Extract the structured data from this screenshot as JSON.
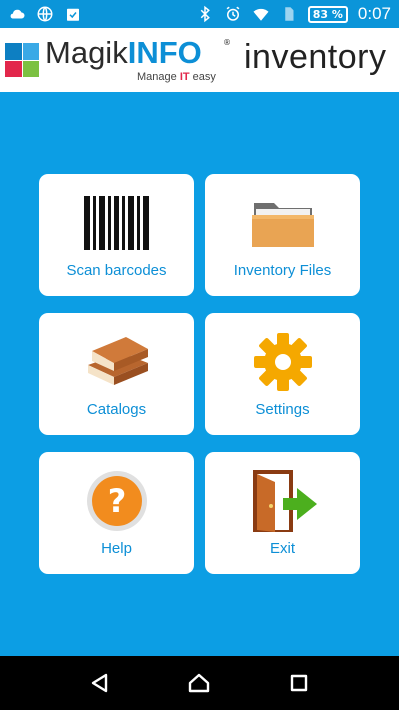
{
  "status_bar": {
    "battery_text": "83 %",
    "time": "0:07",
    "left_icons": [
      "cloud-icon",
      "globe-icon",
      "clipboard-check-icon"
    ],
    "right_icons": [
      "bluetooth-icon",
      "alarm-icon",
      "wifi-icon",
      "sim-icon"
    ]
  },
  "header": {
    "brand_magik": "Magik",
    "brand_info": "INFO",
    "registered": "®",
    "tagline_pre": "Manage ",
    "tagline_it": "IT",
    "tagline_post": " easy",
    "app_title": "inventory"
  },
  "tiles": [
    {
      "label": "Scan barcodes",
      "icon": "barcode-icon"
    },
    {
      "label": "Inventory Files",
      "icon": "folder-icon"
    },
    {
      "label": "Catalogs",
      "icon": "books-icon"
    },
    {
      "label": "Settings",
      "icon": "gear-icon"
    },
    {
      "label": "Help",
      "icon": "help-icon"
    },
    {
      "label": "Exit",
      "icon": "exit-door-icon"
    }
  ],
  "nav": {
    "buttons": [
      "back-icon",
      "home-icon",
      "recents-icon"
    ]
  },
  "colors": {
    "background": "#0c9ee4",
    "accent_text": "#0d8fd6",
    "tile_bg": "#ffffff"
  }
}
